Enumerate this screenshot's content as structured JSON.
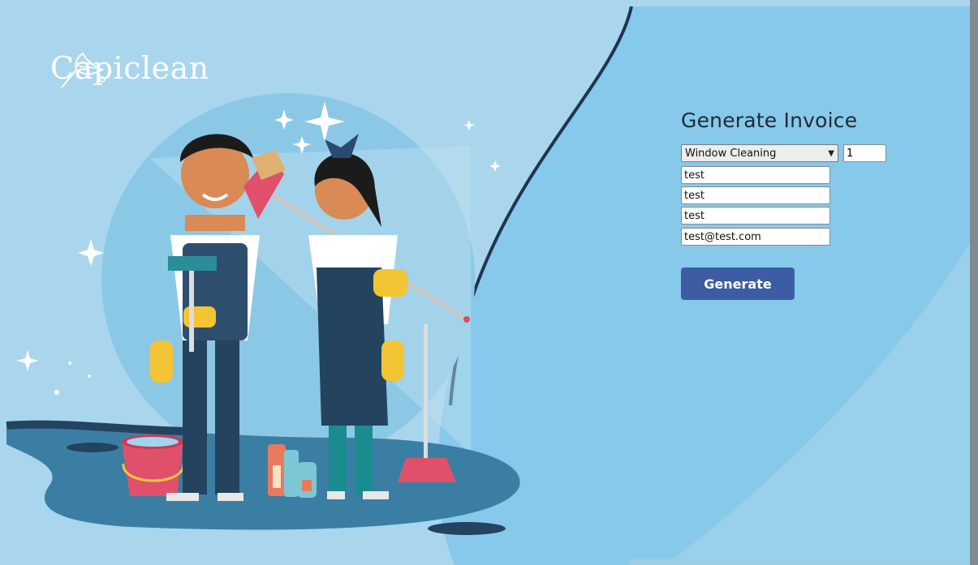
{
  "brand": {
    "name": "Capiclean",
    "logo_icon": "feather-duster-icon"
  },
  "form": {
    "title": "Generate Invoice",
    "service_select": {
      "selected": "Window Cleaning"
    },
    "quantity": "1",
    "fields": [
      "test",
      "test",
      "test",
      "test@test.com"
    ],
    "button_label": "Generate"
  },
  "colors": {
    "background": "#a9d6ec",
    "panel": "#87c9ea",
    "button": "#3c5ca4",
    "dark_navy": "#23435f"
  }
}
